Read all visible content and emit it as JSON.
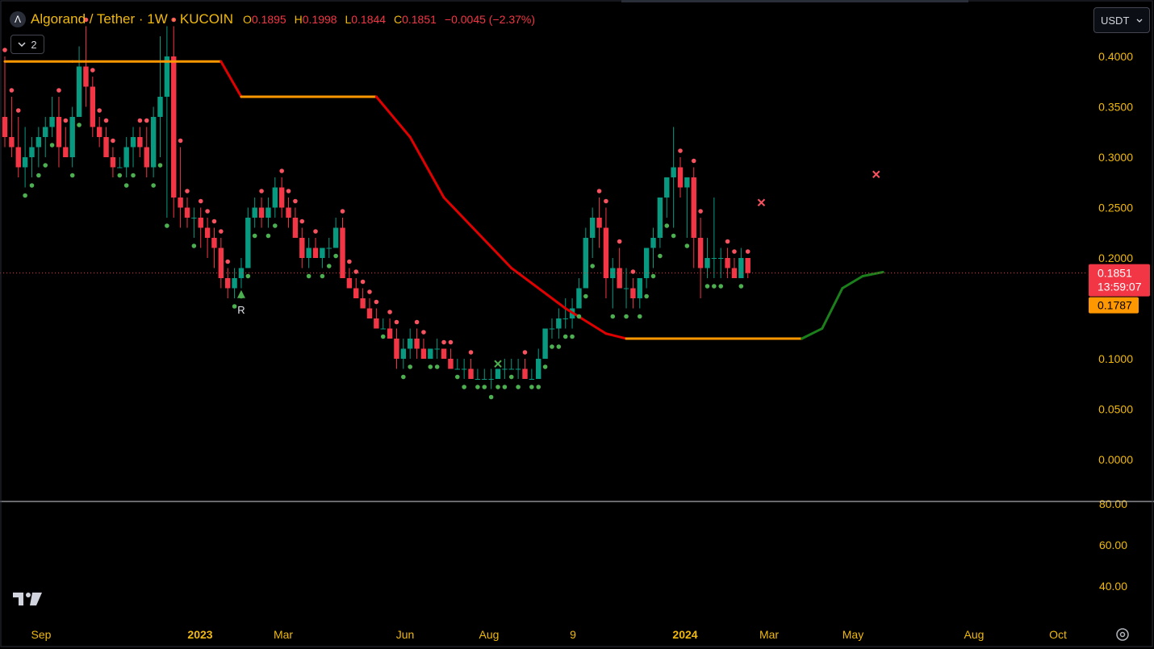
{
  "header": {
    "symbol_title": "Algorand / Tether · 1W · KUCOIN",
    "ohlc": [
      {
        "key": "O",
        "value": "0.1895"
      },
      {
        "key": "H",
        "value": "0.1998"
      },
      {
        "key": "L",
        "value": "0.1844"
      },
      {
        "key": "C",
        "value": "0.1851"
      }
    ],
    "change": "−0.0045 (−2.37%)",
    "collapse_count": "2",
    "currency": "USDT"
  },
  "colors": {
    "up": "#089981",
    "down": "#f23645",
    "accent": "#f0b90b",
    "trail_down": "#e00000",
    "trail_up": "#1b7f1b",
    "trail_flat": "#ff9800"
  },
  "price_label": {
    "price": "0.1851",
    "countdown": "13:59:07",
    "trail_value": "0.1787"
  },
  "chart_data": [
    {
      "type": "candlestick",
      "title": "Algorand / Tether · 1W · KUCOIN",
      "ylim": [
        -0.05,
        0.43
      ],
      "y_ticks": [
        "0.4000",
        "0.3500",
        "0.3000",
        "0.2500",
        "0.2000",
        "0.1500",
        "0.1000",
        "0.0500",
        "0.0000"
      ],
      "x_labels": [
        "Sep",
        "2023",
        "Mar",
        "Jun",
        "Aug",
        "9",
        "2024",
        "Mar",
        "May",
        "Aug",
        "Oct"
      ],
      "candles": [
        [
          0.34,
          0.4,
          0.31,
          0.32
        ],
        [
          0.32,
          0.36,
          0.3,
          0.31
        ],
        [
          0.31,
          0.34,
          0.28,
          0.29
        ],
        [
          0.29,
          0.33,
          0.27,
          0.3
        ],
        [
          0.3,
          0.32,
          0.28,
          0.31
        ],
        [
          0.31,
          0.33,
          0.29,
          0.32
        ],
        [
          0.32,
          0.34,
          0.3,
          0.33
        ],
        [
          0.33,
          0.36,
          0.32,
          0.34
        ],
        [
          0.34,
          0.36,
          0.29,
          0.31
        ],
        [
          0.31,
          0.33,
          0.3,
          0.3
        ],
        [
          0.3,
          0.35,
          0.29,
          0.34
        ],
        [
          0.34,
          0.41,
          0.34,
          0.39
        ],
        [
          0.39,
          0.43,
          0.35,
          0.37
        ],
        [
          0.37,
          0.38,
          0.32,
          0.33
        ],
        [
          0.33,
          0.34,
          0.31,
          0.32
        ],
        [
          0.32,
          0.33,
          0.3,
          0.3
        ],
        [
          0.3,
          0.31,
          0.28,
          0.29
        ],
        [
          0.29,
          0.3,
          0.29,
          0.29
        ],
        [
          0.29,
          0.32,
          0.28,
          0.31
        ],
        [
          0.31,
          0.33,
          0.29,
          0.32
        ],
        [
          0.32,
          0.33,
          0.3,
          0.31
        ],
        [
          0.31,
          0.33,
          0.28,
          0.29
        ],
        [
          0.29,
          0.35,
          0.28,
          0.34
        ],
        [
          0.34,
          0.42,
          0.3,
          0.36
        ],
        [
          0.36,
          0.43,
          0.24,
          0.4
        ],
        [
          0.4,
          0.43,
          0.24,
          0.26
        ],
        [
          0.26,
          0.31,
          0.23,
          0.25
        ],
        [
          0.25,
          0.26,
          0.23,
          0.24
        ],
        [
          0.24,
          0.25,
          0.22,
          0.24
        ],
        [
          0.24,
          0.25,
          0.21,
          0.23
        ],
        [
          0.23,
          0.24,
          0.2,
          0.22
        ],
        [
          0.22,
          0.23,
          0.19,
          0.21
        ],
        [
          0.21,
          0.22,
          0.17,
          0.18
        ],
        [
          0.18,
          0.19,
          0.16,
          0.17
        ],
        [
          0.17,
          0.19,
          0.16,
          0.18
        ],
        [
          0.18,
          0.2,
          0.17,
          0.19
        ],
        [
          0.19,
          0.25,
          0.19,
          0.24
        ],
        [
          0.24,
          0.26,
          0.23,
          0.25
        ],
        [
          0.25,
          0.26,
          0.23,
          0.24
        ],
        [
          0.24,
          0.26,
          0.23,
          0.25
        ],
        [
          0.25,
          0.28,
          0.24,
          0.27
        ],
        [
          0.27,
          0.28,
          0.24,
          0.25
        ],
        [
          0.25,
          0.26,
          0.23,
          0.24
        ],
        [
          0.24,
          0.25,
          0.22,
          0.22
        ],
        [
          0.22,
          0.23,
          0.19,
          0.2
        ],
        [
          0.2,
          0.22,
          0.19,
          0.21
        ],
        [
          0.21,
          0.22,
          0.2,
          0.2
        ],
        [
          0.2,
          0.21,
          0.19,
          0.21
        ],
        [
          0.21,
          0.22,
          0.2,
          0.21
        ],
        [
          0.21,
          0.24,
          0.21,
          0.23
        ],
        [
          0.23,
          0.24,
          0.19,
          0.18
        ],
        [
          0.18,
          0.19,
          0.17,
          0.17
        ],
        [
          0.17,
          0.18,
          0.16,
          0.16
        ],
        [
          0.16,
          0.17,
          0.15,
          0.15
        ],
        [
          0.15,
          0.16,
          0.14,
          0.14
        ],
        [
          0.14,
          0.15,
          0.14,
          0.13
        ],
        [
          0.13,
          0.14,
          0.13,
          0.13
        ],
        [
          0.13,
          0.14,
          0.12,
          0.12
        ],
        [
          0.12,
          0.13,
          0.09,
          0.1
        ],
        [
          0.1,
          0.12,
          0.09,
          0.11
        ],
        [
          0.11,
          0.13,
          0.1,
          0.12
        ],
        [
          0.12,
          0.13,
          0.1,
          0.11
        ],
        [
          0.11,
          0.12,
          0.1,
          0.1
        ],
        [
          0.1,
          0.11,
          0.1,
          0.11
        ],
        [
          0.11,
          0.12,
          0.1,
          0.11
        ],
        [
          0.11,
          0.11,
          0.1,
          0.1
        ],
        [
          0.1,
          0.11,
          0.09,
          0.09
        ],
        [
          0.09,
          0.1,
          0.09,
          0.09
        ],
        [
          0.09,
          0.1,
          0.08,
          0.09
        ],
        [
          0.09,
          0.1,
          0.09,
          0.08
        ],
        [
          0.08,
          0.09,
          0.08,
          0.08
        ],
        [
          0.08,
          0.09,
          0.08,
          0.08
        ],
        [
          0.08,
          0.09,
          0.07,
          0.08
        ],
        [
          0.08,
          0.09,
          0.08,
          0.09
        ],
        [
          0.09,
          0.1,
          0.08,
          0.09
        ],
        [
          0.09,
          0.1,
          0.09,
          0.09
        ],
        [
          0.09,
          0.1,
          0.08,
          0.09
        ],
        [
          0.09,
          0.1,
          0.08,
          0.08
        ],
        [
          0.08,
          0.09,
          0.08,
          0.08
        ],
        [
          0.08,
          0.11,
          0.08,
          0.1
        ],
        [
          0.1,
          0.13,
          0.1,
          0.13
        ],
        [
          0.13,
          0.14,
          0.12,
          0.13
        ],
        [
          0.13,
          0.15,
          0.12,
          0.14
        ],
        [
          0.14,
          0.16,
          0.13,
          0.14
        ],
        [
          0.14,
          0.16,
          0.13,
          0.15
        ],
        [
          0.15,
          0.18,
          0.15,
          0.17
        ],
        [
          0.17,
          0.23,
          0.17,
          0.22
        ],
        [
          0.22,
          0.25,
          0.2,
          0.24
        ],
        [
          0.24,
          0.26,
          0.21,
          0.23
        ],
        [
          0.23,
          0.25,
          0.16,
          0.18
        ],
        [
          0.18,
          0.2,
          0.15,
          0.19
        ],
        [
          0.19,
          0.21,
          0.17,
          0.17
        ],
        [
          0.17,
          0.19,
          0.15,
          0.17
        ],
        [
          0.17,
          0.18,
          0.15,
          0.16
        ],
        [
          0.16,
          0.18,
          0.15,
          0.18
        ],
        [
          0.18,
          0.21,
          0.17,
          0.21
        ],
        [
          0.21,
          0.23,
          0.19,
          0.22
        ],
        [
          0.22,
          0.26,
          0.21,
          0.26
        ],
        [
          0.26,
          0.28,
          0.24,
          0.28
        ],
        [
          0.28,
          0.33,
          0.23,
          0.29
        ],
        [
          0.29,
          0.3,
          0.26,
          0.27
        ],
        [
          0.27,
          0.28,
          0.22,
          0.28
        ],
        [
          0.28,
          0.29,
          0.19,
          0.22
        ],
        [
          0.22,
          0.24,
          0.16,
          0.19
        ],
        [
          0.19,
          0.22,
          0.18,
          0.2
        ],
        [
          0.2,
          0.26,
          0.18,
          0.2
        ],
        [
          0.2,
          0.21,
          0.18,
          0.2
        ],
        [
          0.2,
          0.21,
          0.18,
          0.19
        ],
        [
          0.19,
          0.2,
          0.18,
          0.18
        ],
        [
          0.18,
          0.21,
          0.18,
          0.2
        ],
        [
          0.2,
          0.2,
          0.18,
          0.1851
        ]
      ],
      "trail_stop": [
        [
          0,
          0.395
        ],
        [
          10,
          0.395
        ],
        [
          24,
          0.395
        ],
        [
          32,
          0.395
        ],
        [
          35,
          0.36
        ],
        [
          55,
          0.36
        ],
        [
          60,
          0.32
        ],
        [
          65,
          0.26
        ],
        [
          75,
          0.19
        ],
        [
          83,
          0.15
        ],
        [
          89,
          0.125
        ],
        [
          92,
          0.12
        ],
        [
          118,
          0.12
        ],
        [
          121,
          0.13
        ],
        [
          124,
          0.17
        ],
        [
          127,
          0.182
        ],
        [
          130,
          0.186
        ]
      ],
      "markers": [
        {
          "type": "R",
          "at": 35,
          "price": 0.165,
          "text": "R"
        },
        {
          "type": "x-up",
          "at": 73,
          "price": 0.095
        },
        {
          "type": "x-down",
          "at": 112,
          "price": 0.255
        },
        {
          "type": "x-down",
          "at": 129,
          "price": 0.283
        }
      ]
    },
    {
      "type": "line",
      "title": "",
      "ylim": [
        30,
        82
      ],
      "y_ticks": [
        "80.00",
        "60.00",
        "40.00"
      ],
      "series": []
    }
  ]
}
